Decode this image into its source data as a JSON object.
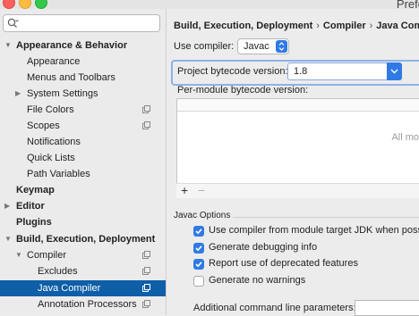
{
  "window": {
    "title": "Prefe"
  },
  "search": {
    "placeholder": ""
  },
  "sidebar": {
    "items": [
      {
        "label": "Appearance & Behavior",
        "bold": true,
        "expanded": true
      },
      {
        "label": "Appearance"
      },
      {
        "label": "Menus and Toolbars"
      },
      {
        "label": "System Settings",
        "expandable": true
      },
      {
        "label": "File Colors",
        "icon": "project-config-icon"
      },
      {
        "label": "Scopes",
        "icon": "project-config-icon"
      },
      {
        "label": "Notifications"
      },
      {
        "label": "Quick Lists"
      },
      {
        "label": "Path Variables"
      },
      {
        "label": "Keymap",
        "bold": true
      },
      {
        "label": "Editor",
        "bold": true,
        "expandable": true
      },
      {
        "label": "Plugins",
        "bold": true
      },
      {
        "label": "Build, Execution, Deployment",
        "bold": true,
        "expanded": true
      },
      {
        "label": "Compiler",
        "expanded": true,
        "icon": "project-config-icon"
      },
      {
        "label": "Excludes",
        "icon": "project-config-icon"
      },
      {
        "label": "Java Compiler",
        "selected": true,
        "icon": "project-config-icon"
      },
      {
        "label": "Annotation Processors",
        "icon": "project-config-icon"
      }
    ]
  },
  "breadcrumb": [
    "Build, Execution, Deployment",
    "Compiler",
    "Java Comp"
  ],
  "compiler": {
    "label": "Use compiler:",
    "value": "Javac"
  },
  "bytecode": {
    "label": "Project bytecode version:",
    "value": "1.8"
  },
  "per_module": {
    "label": "Per-module bytecode version:",
    "empty_text": "All mo",
    "add": "+",
    "remove": "−"
  },
  "javac_options": {
    "title": "Javac Options",
    "checkboxes": [
      {
        "label": "Use compiler from module target JDK when possib",
        "checked": true
      },
      {
        "label": "Generate debugging info",
        "checked": true
      },
      {
        "label": "Report use of deprecated features",
        "checked": true
      },
      {
        "label": "Generate no warnings",
        "checked": false
      }
    ],
    "additional_label": "Additional command line parameters:"
  },
  "colors": {
    "accent": "#2f7ae5",
    "selection": "#0e5ea8"
  }
}
